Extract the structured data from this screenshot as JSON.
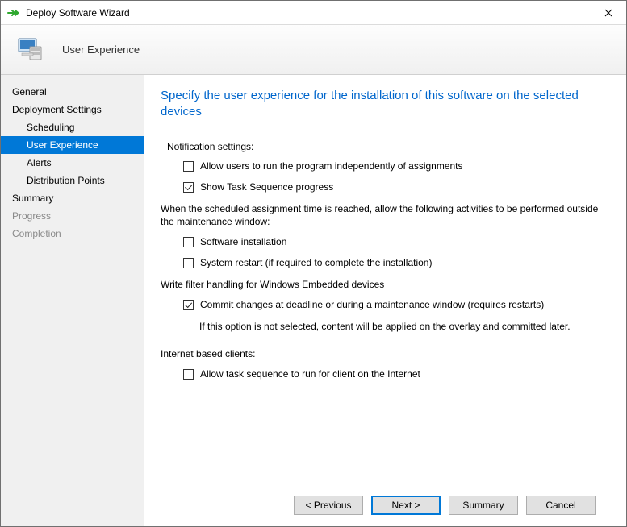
{
  "window": {
    "title": "Deploy Software Wizard"
  },
  "header": {
    "title": "User Experience"
  },
  "sidebar": {
    "items": [
      {
        "label": "General",
        "level": 0,
        "state": "normal"
      },
      {
        "label": "Deployment Settings",
        "level": 0,
        "state": "normal"
      },
      {
        "label": "Scheduling",
        "level": 1,
        "state": "normal"
      },
      {
        "label": "User Experience",
        "level": 1,
        "state": "selected"
      },
      {
        "label": "Alerts",
        "level": 1,
        "state": "normal"
      },
      {
        "label": "Distribution Points",
        "level": 1,
        "state": "normal"
      },
      {
        "label": "Summary",
        "level": 0,
        "state": "normal"
      },
      {
        "label": "Progress",
        "level": 0,
        "state": "disabled"
      },
      {
        "label": "Completion",
        "level": 0,
        "state": "disabled"
      }
    ]
  },
  "main": {
    "heading": "Specify the user experience for the installation of this software on the selected devices",
    "notification_label": "Notification settings:",
    "cb_allow_run": {
      "label": "Allow users to run the program independently of assignments",
      "checked": false
    },
    "cb_show_progress": {
      "label": "Show Task Sequence progress",
      "checked": true
    },
    "maintenance_desc": "When the scheduled assignment time is reached, allow the following activities to be performed outside the maintenance window:",
    "cb_software_install": {
      "label": "Software installation",
      "checked": false
    },
    "cb_system_restart": {
      "label": "System restart (if required to complete the installation)",
      "checked": false
    },
    "embedded_label": "Write filter handling for Windows Embedded devices",
    "cb_commit": {
      "label": "Commit changes at deadline or during a maintenance window (requires restarts)",
      "checked": true
    },
    "commit_hint": "If this option is not selected, content will be applied on the overlay and committed later.",
    "internet_label": "Internet based clients:",
    "cb_internet": {
      "label": "Allow task sequence to run for client on the Internet",
      "checked": false
    }
  },
  "footer": {
    "previous": "< Previous",
    "next": "Next >",
    "summary": "Summary",
    "cancel": "Cancel"
  }
}
